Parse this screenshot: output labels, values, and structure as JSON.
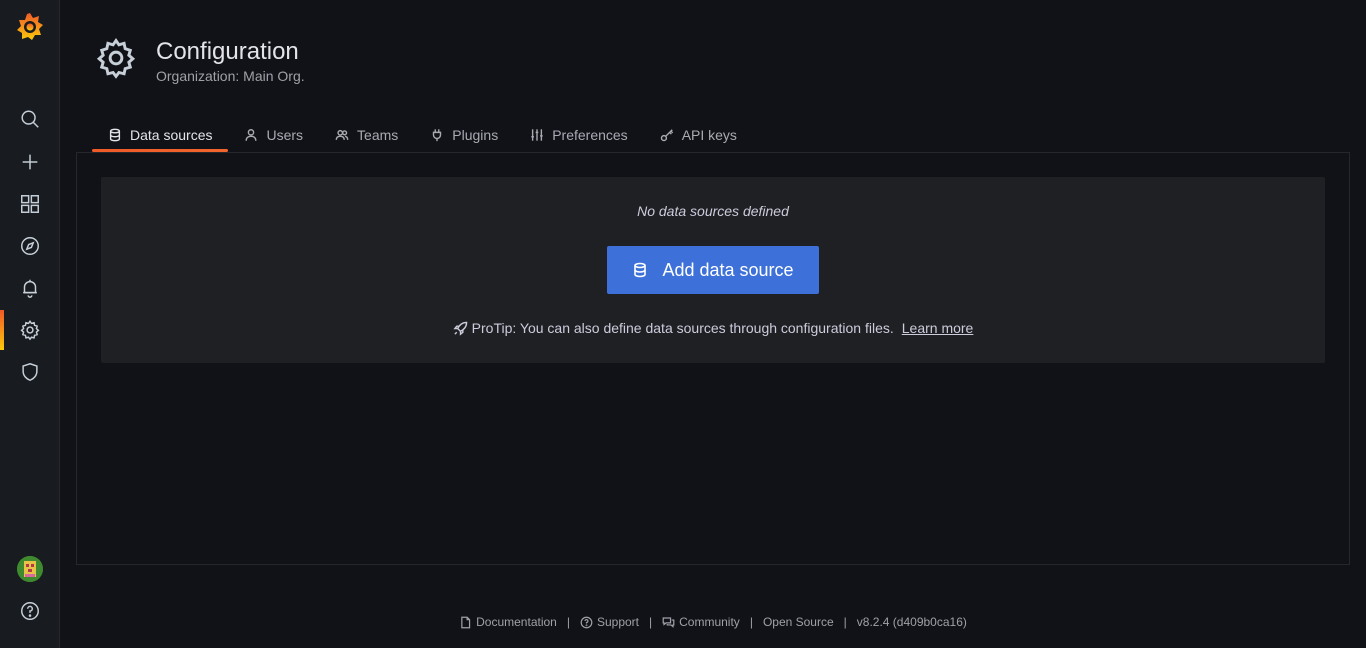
{
  "app": {
    "brand_color": "#f05a28",
    "accent_color": "#3d71d9"
  },
  "sidebar": {
    "items": [
      {
        "name": "search",
        "icon": "search-icon"
      },
      {
        "name": "create",
        "icon": "plus-icon"
      },
      {
        "name": "dashboards",
        "icon": "apps-icon"
      },
      {
        "name": "explore",
        "icon": "compass-icon"
      },
      {
        "name": "alerting",
        "icon": "bell-icon"
      },
      {
        "name": "configuration",
        "icon": "gear-icon",
        "active": true
      },
      {
        "name": "server-admin",
        "icon": "shield-icon"
      }
    ],
    "bottom": [
      {
        "name": "profile",
        "icon": "avatar"
      },
      {
        "name": "help",
        "icon": "question-icon"
      }
    ]
  },
  "header": {
    "title": "Configuration",
    "subtitle": "Organization: Main Org."
  },
  "tabs": [
    {
      "label": "Data sources",
      "icon": "database-icon",
      "active": true
    },
    {
      "label": "Users",
      "icon": "user-icon"
    },
    {
      "label": "Teams",
      "icon": "users-icon"
    },
    {
      "label": "Plugins",
      "icon": "plug-icon"
    },
    {
      "label": "Preferences",
      "icon": "sliders-icon"
    },
    {
      "label": "API keys",
      "icon": "key-icon"
    }
  ],
  "empty_state": {
    "title": "No data sources defined",
    "button_label": "Add data source",
    "protip": "ProTip: You can also define data sources through configuration files.",
    "learn_more": "Learn more"
  },
  "footer": {
    "documentation": "Documentation",
    "support": "Support",
    "community": "Community",
    "open_source": "Open Source",
    "version": "v8.2.4 (d409b0ca16)"
  }
}
